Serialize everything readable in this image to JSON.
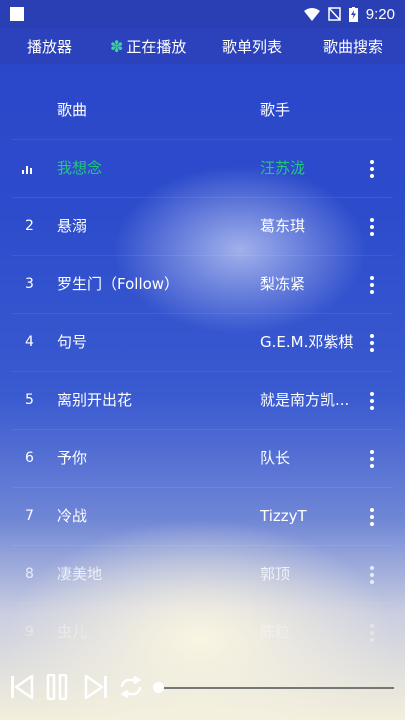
{
  "status_bar": {
    "time": "9:20"
  },
  "tabs": {
    "player": "播放器",
    "now_playing": "正在播放",
    "playlist": "歌单列表",
    "search": "歌曲搜索"
  },
  "list_header": {
    "song": "歌曲",
    "artist": "歌手"
  },
  "songs": [
    {
      "num": "",
      "title": "我想念",
      "artist": "汪苏泷"
    },
    {
      "num": "2",
      "title": "悬溺",
      "artist": "葛东琪"
    },
    {
      "num": "3",
      "title": "罗生门（Follow）",
      "artist": "梨冻紧"
    },
    {
      "num": "4",
      "title": "句号",
      "artist": "G.E.M.邓紫棋"
    },
    {
      "num": "5",
      "title": "离别开出花",
      "artist": "就是南方凯..."
    },
    {
      "num": "6",
      "title": "予你",
      "artist": "队长"
    },
    {
      "num": "7",
      "title": "冷战",
      "artist": "TizzyT"
    },
    {
      "num": "8",
      "title": "凄美地",
      "artist": "郭顶"
    },
    {
      "num": "9",
      "title": "虫儿",
      "artist": "陈粒"
    }
  ],
  "player": {
    "progress": 0.0
  },
  "colors": {
    "accent": "#25c77e",
    "tabbar": "#2c42bd",
    "statusbar": "#2a3fb3"
  }
}
